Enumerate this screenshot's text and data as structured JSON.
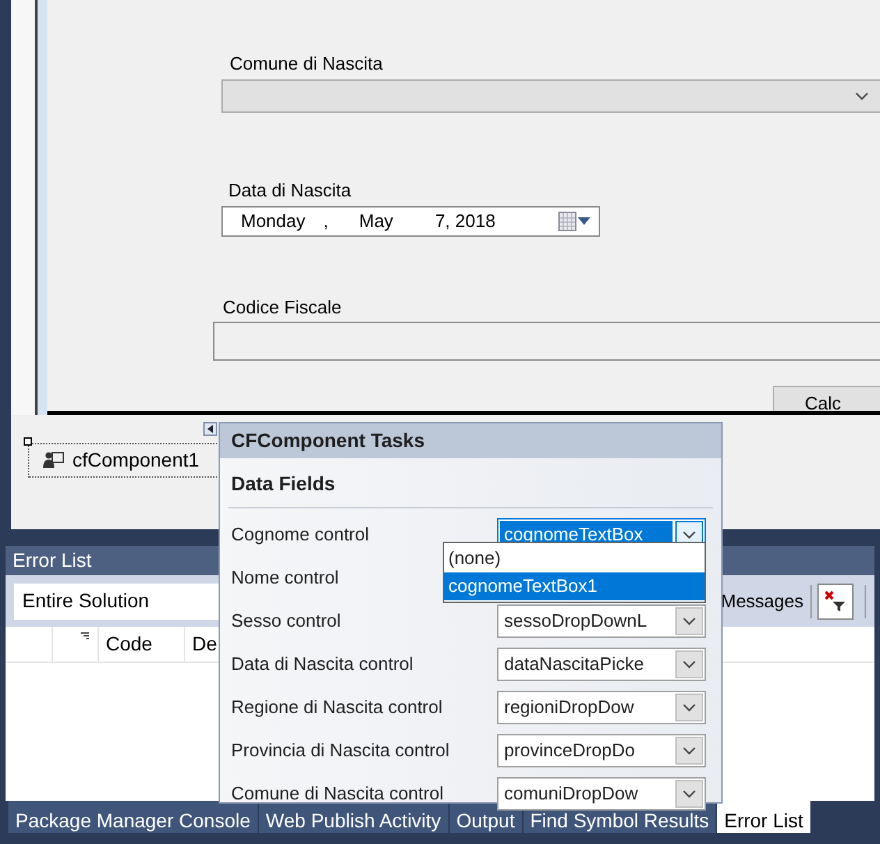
{
  "designer": {
    "fields": [
      {
        "kind": "combo",
        "label": "Comune di Nascita",
        "disabled": true
      },
      {
        "kind": "date",
        "label": "Data di Nascita",
        "weekday": "Monday",
        "separator": ",",
        "month": "May",
        "day_year": "7, 2018"
      },
      {
        "kind": "text",
        "label": "Codice Fiscale"
      }
    ],
    "button": "Calc"
  },
  "tray": {
    "component": "cfComponent1",
    "selected": true
  },
  "smart_tag": {
    "title": "CFComponent Tasks",
    "section": "Data Fields",
    "rows": [
      {
        "label": "Cognome control",
        "value": "cognomeTextBox",
        "focused": true
      },
      {
        "label": "Nome control"
      },
      {
        "label": "Sesso control",
        "value": "sessoDropDownL",
        "focused": false
      },
      {
        "label": "Data di Nascita control",
        "value": "dataNascitaPicke",
        "focused": false
      },
      {
        "label": "Regione di Nascita control",
        "value": "regioniDropDow",
        "focused": false
      },
      {
        "label": "Provincia di Nascita control",
        "value": "provinceDropDo",
        "focused": false
      },
      {
        "label": "Comune di Nascita control",
        "value": "comuniDropDow",
        "focused": false
      }
    ],
    "dropdown": {
      "items": [
        {
          "label": "(none)",
          "selected": false
        },
        {
          "label": "cognomeTextBox1",
          "selected": true
        }
      ]
    }
  },
  "error_list": {
    "title": "Error List",
    "scope": "Entire Solution",
    "filter_label": "Messages",
    "columns": [
      "Code",
      "De"
    ]
  },
  "bottom_tabs": [
    {
      "label": "Package Manager Console",
      "selected": false
    },
    {
      "label": "Web Publish Activity",
      "selected": false
    },
    {
      "label": "Output",
      "selected": false
    },
    {
      "label": "Find Symbol Results",
      "selected": false
    },
    {
      "label": "Error List",
      "selected": true
    }
  ]
}
